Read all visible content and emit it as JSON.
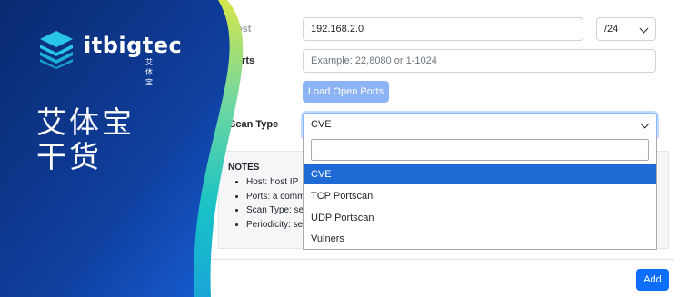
{
  "banner": {
    "logo_text": "itbigtec",
    "logo_sub": "艾体宝",
    "headline_line1": "艾体宝",
    "headline_line2": "干货",
    "colors": {
      "navy": "#0b2a6b",
      "blue": "#1a63d8",
      "teal": "#1ec7c2",
      "yellow": "#d7e64a"
    }
  },
  "form": {
    "host_label": "Host",
    "host_value": "192.168.2.0",
    "mask_value": "/24",
    "ports_label": "Ports",
    "ports_placeholder": "Example: 22,8080 or 1-1024",
    "load_ports_button": "Load Open Ports",
    "scan_type_label": "Scan Type",
    "scan_type_value": "CVE",
    "dropdown_options": [
      "CVE",
      "TCP Portscan",
      "UDP Portscan",
      "Vulners"
    ],
    "selected_option_index": 0
  },
  "notes": {
    "title": "NOTES",
    "items": [
      "Host: host IP",
      "Ports: a comm",
      "Scan Type: se",
      "Periodicity: se"
    ]
  },
  "footer": {
    "add_button": "Add"
  },
  "accent_color": "#0d6efd"
}
